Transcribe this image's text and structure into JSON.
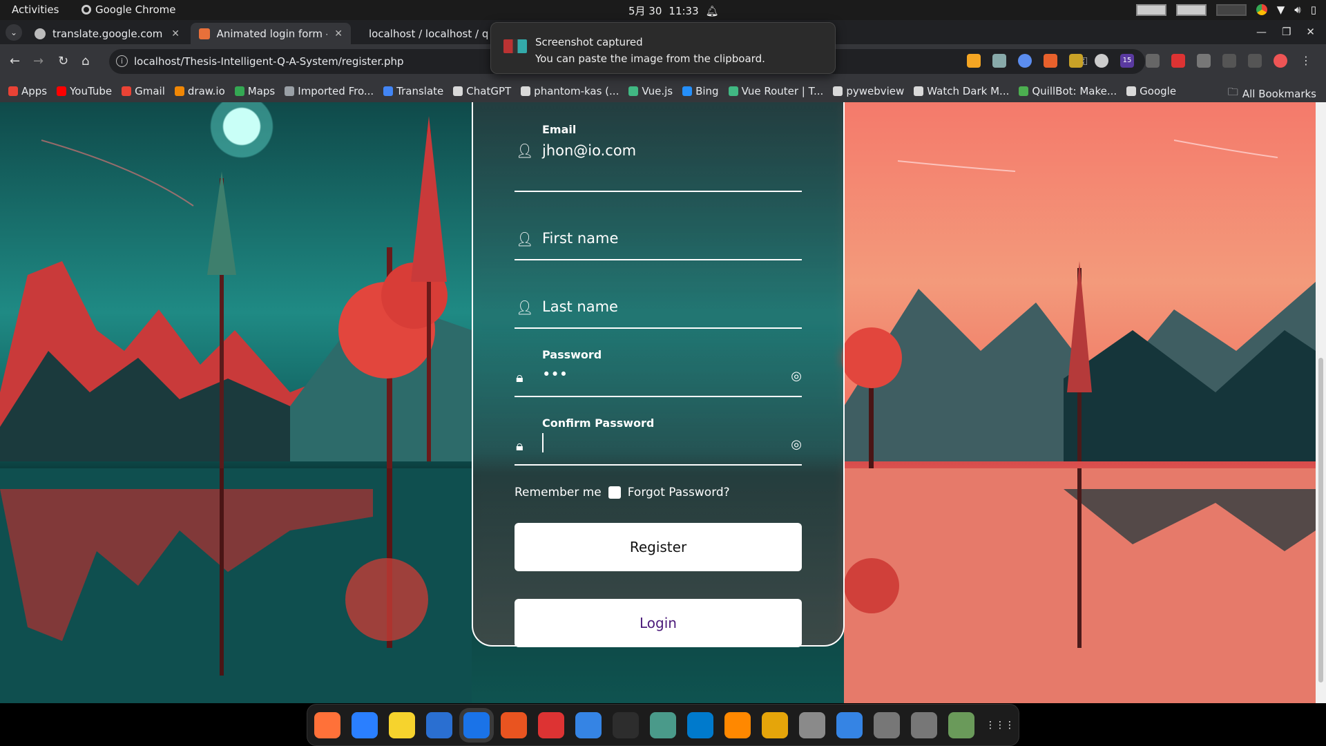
{
  "system_bar": {
    "activities": "Activities",
    "app_name": "Google Chrome",
    "date": "5月 30",
    "time": "11:33"
  },
  "tabs": [
    {
      "title": "translate.google.com",
      "favicon_color": "#bbbbbb"
    },
    {
      "title": "Animated login form - Bo",
      "favicon_color": "#e8703a"
    },
    {
      "title": "localhost / localhost / q",
      "favicon_color": "#f0a030"
    }
  ],
  "toast": {
    "title": "Screenshot captured",
    "body": "You can paste the image from the clipboard."
  },
  "address_bar": {
    "url": "localhost/Thesis-Intelligent-Q-A-System/register.php"
  },
  "extension_badge": "15",
  "bookmarks": [
    {
      "label": "Apps",
      "color": "#e94235"
    },
    {
      "label": "YouTube",
      "color": "#ff0000"
    },
    {
      "label": "Gmail",
      "color": "#ea4335"
    },
    {
      "label": "draw.io",
      "color": "#f08705"
    },
    {
      "label": "Maps",
      "color": "#34a853"
    },
    {
      "label": "Imported Fro...",
      "color": "#9aa0a6"
    },
    {
      "label": "Translate",
      "color": "#4285f4"
    },
    {
      "label": "ChatGPT",
      "color": "#d9d9d9"
    },
    {
      "label": "phantom-kas (...",
      "color": "#d9d9d9"
    },
    {
      "label": "Vue.js",
      "color": "#41b883"
    },
    {
      "label": "Bing",
      "color": "#258ffa"
    },
    {
      "label": "Vue Router | T...",
      "color": "#41b883"
    },
    {
      "label": "pywebview",
      "color": "#d9d9d9"
    },
    {
      "label": "Watch Dark M...",
      "color": "#d9d9d9"
    },
    {
      "label": "QuillBot: Make...",
      "color": "#4caf50"
    },
    {
      "label": "Google",
      "color": "#d9d9d9"
    }
  ],
  "all_bookmarks": "All Bookmarks",
  "form": {
    "email_label": "Email",
    "email_value": "jhon@io.com",
    "first_name_placeholder": "First name",
    "last_name_placeholder": "Last name",
    "password_label": "Password",
    "password_value": "•••",
    "confirm_label": "Confirm Password",
    "remember_label": "Remember me",
    "forgot_label": "Forgot Password?",
    "register_label": "Register",
    "login_label": "Login",
    "login_color": "#4b1a7a"
  },
  "dock_apps": [
    {
      "name": "firefox-icon",
      "color": "#ff7139"
    },
    {
      "name": "thunderbird-icon",
      "color": "#2a7fff"
    },
    {
      "name": "rhythmbox-icon",
      "color": "#f6d32d"
    },
    {
      "name": "writer-icon",
      "color": "#2a6fd1"
    },
    {
      "name": "chrome-icon",
      "color": "#1a73e8"
    },
    {
      "name": "software-icon",
      "color": "#e95420"
    },
    {
      "name": "installer-icon",
      "color": "#d33"
    },
    {
      "name": "help-icon",
      "color": "#3584e4"
    },
    {
      "name": "terminal-icon",
      "color": "#2d2d2d"
    },
    {
      "name": "settings-icon",
      "color": "#4a9a8a"
    },
    {
      "name": "vscode-icon",
      "color": "#007acc"
    },
    {
      "name": "vlc-icon",
      "color": "#ff8800"
    },
    {
      "name": "calculator-icon",
      "color": "#e5a50a"
    },
    {
      "name": "files-icon",
      "color": "#8a8a8a"
    },
    {
      "name": "updater-icon",
      "color": "#3584e4"
    },
    {
      "name": "disk-icon",
      "color": "#777777"
    },
    {
      "name": "disk2-icon",
      "color": "#777777"
    },
    {
      "name": "trash-icon",
      "color": "#6a9a5a"
    },
    {
      "name": "app-grid-icon",
      "color": "#1c1c1c"
    }
  ]
}
